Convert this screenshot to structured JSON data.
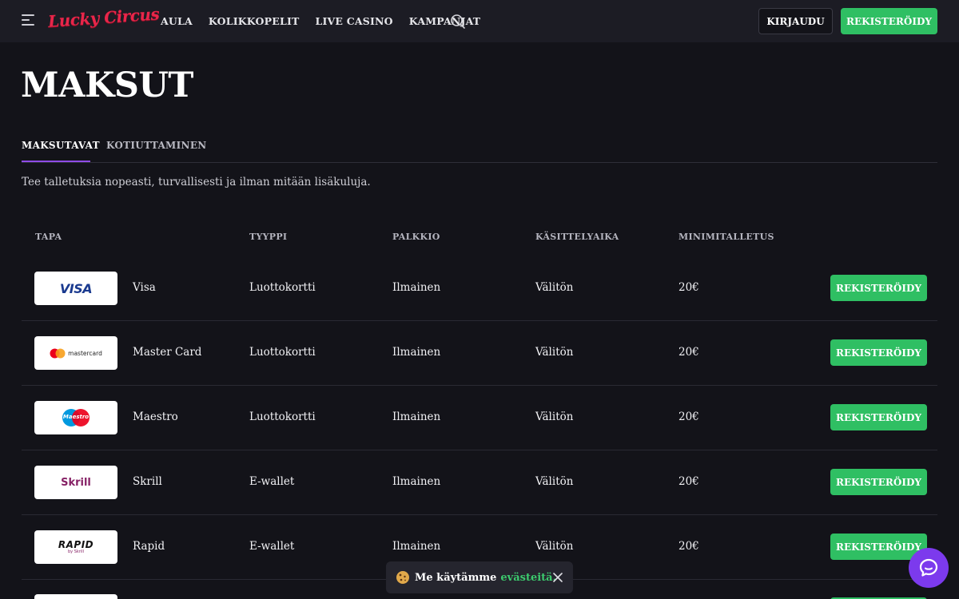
{
  "header": {
    "logo_text": "Lucky Circus",
    "nav": [
      "AULA",
      "KOLIKKOPELIT",
      "LIVE CASINO",
      "KAMPANJAT"
    ],
    "login_label": "KIRJAUDU",
    "register_label": "REKISTERÖIDY"
  },
  "page": {
    "title": "MAKSUT",
    "tabs": [
      "MAKSUTAVAT",
      "KOTIUTTAMINEN"
    ],
    "intro": "Tee talletuksia nopeasti, turvallisesti ja ilman mitään lisäkuluja."
  },
  "table": {
    "headers": [
      "TAPA",
      "TYYPPI",
      "PALKKIO",
      "KÄSITTELYAIKA",
      "MINIMITALLETUS"
    ],
    "rows": [
      {
        "name": "Visa",
        "type": "Luottokortti",
        "fee": "Ilmainen",
        "time": "Välitön",
        "min": "20€",
        "button": "REKISTERÖIDY",
        "logo": "VISA"
      },
      {
        "name": "Master Card",
        "type": "Luottokortti",
        "fee": "Ilmainen",
        "time": "Välitön",
        "min": "20€",
        "button": "REKISTERÖIDY",
        "logo": "mastercard"
      },
      {
        "name": "Maestro",
        "type": "Luottokortti",
        "fee": "Ilmainen",
        "time": "Välitön",
        "min": "20€",
        "button": "REKISTERÖIDY",
        "logo": "Maestro"
      },
      {
        "name": "Skrill",
        "type": "E-wallet",
        "fee": "Ilmainen",
        "time": "Välitön",
        "min": "20€",
        "button": "REKISTERÖIDY",
        "logo": "Skrill"
      },
      {
        "name": "Rapid",
        "type": "E-wallet",
        "fee": "Ilmainen",
        "time": "Välitön",
        "min": "20€",
        "button": "REKISTERÖIDY",
        "logo": "RAPID",
        "logo_sub": "by Skrill"
      }
    ]
  },
  "cookie": {
    "text": "Me käytämme",
    "link": "evästeitä."
  },
  "colors": {
    "accent_green": "#2fbf63",
    "accent_purple": "#8f4ce8",
    "logo_red": "#e8264a",
    "background": "#131319"
  }
}
